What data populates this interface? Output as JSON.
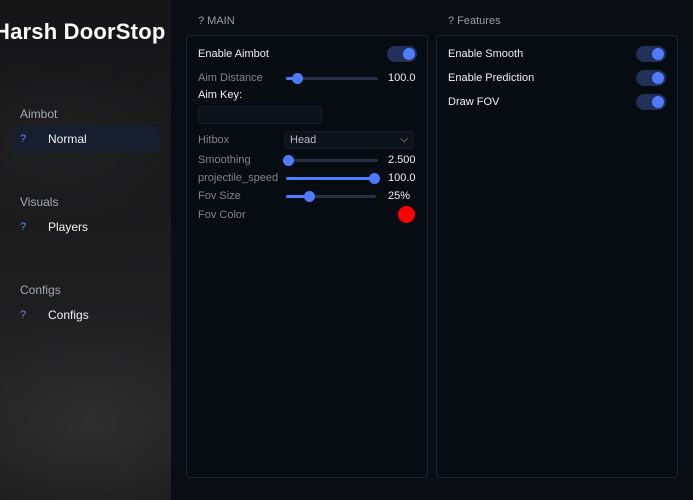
{
  "brand": {
    "title": "Harsh DoorStop"
  },
  "sidebar": {
    "sections": [
      {
        "label": "Aimbot",
        "items": [
          {
            "icon": "?",
            "label": "Normal",
            "active": true
          }
        ]
      },
      {
        "label": "Visuals",
        "items": [
          {
            "icon": "?",
            "label": "Players",
            "active": false
          }
        ]
      },
      {
        "label": "Configs",
        "items": [
          {
            "icon": "?",
            "label": "Configs",
            "active": false
          }
        ]
      }
    ]
  },
  "main_panel": {
    "title": "? MAIN",
    "enable_aimbot": {
      "label": "Enable Aimbot",
      "on": true
    },
    "aim_distance": {
      "label": "Aim Distance",
      "value": "100.0",
      "fraction": 0.12
    },
    "aim_key": {
      "label": "Aim Key:",
      "value": ""
    },
    "hitbox": {
      "label": "Hitbox",
      "value": "Head"
    },
    "smoothing": {
      "label": "Smoothing",
      "value": "2.500",
      "fraction": 0.0
    },
    "projectile_speed": {
      "label": "projectile_speed",
      "value": "100.0",
      "fraction": 1.0
    },
    "fov_size": {
      "label": "Fov Size",
      "value": "25%",
      "fraction": 0.25
    },
    "fov_color": {
      "label": "Fov Color",
      "color": "#ff0000"
    }
  },
  "features_panel": {
    "title": "? Features",
    "toggles": [
      {
        "label": "Enable Smooth",
        "on": true
      },
      {
        "label": "Enable Prediction",
        "on": true
      },
      {
        "label": "Draw FOV",
        "on": true
      }
    ]
  },
  "colors": {
    "accent": "#4f7cff",
    "panel_bg": "#070b12"
  }
}
